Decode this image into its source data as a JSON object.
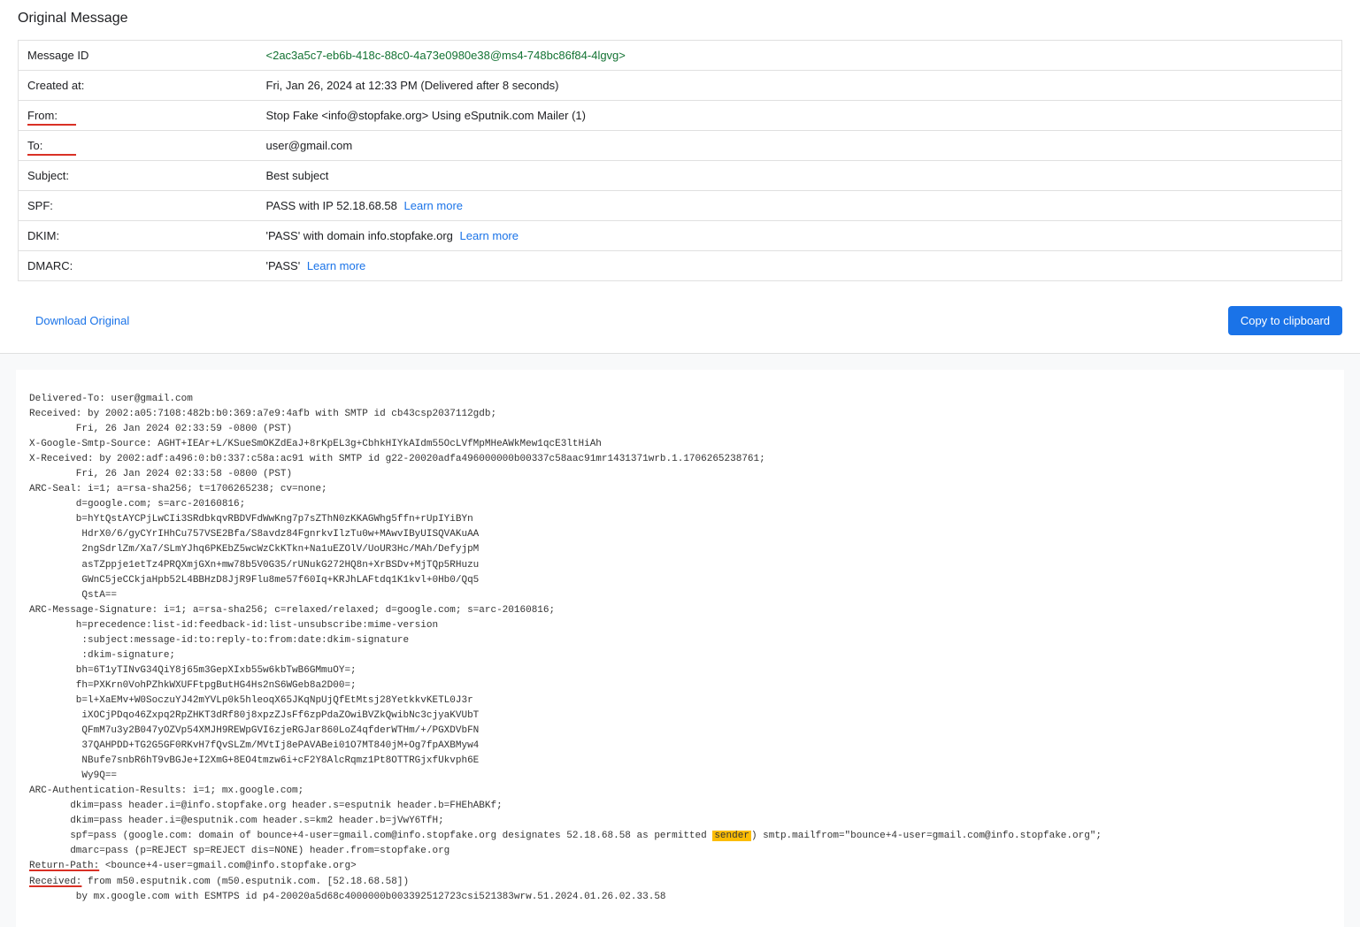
{
  "title": "Original Message",
  "rows": {
    "messageId": {
      "label": "Message ID",
      "value": "<2ac3a5c7-eb6b-418c-88c0-4a73e0980e38@ms4-748bc86f84-4lgvg>"
    },
    "createdAt": {
      "label": "Created at:",
      "value": "Fri, Jan 26, 2024 at 12:33 PM (Delivered after 8 seconds)"
    },
    "from": {
      "label": "From:",
      "value": "Stop Fake <info@stopfake.org> Using eSputnik.com Mailer (1)"
    },
    "to": {
      "label": "To:",
      "value": "user@gmail.com"
    },
    "subject": {
      "label": "Subject:",
      "value": "Best subject"
    },
    "spf": {
      "label": "SPF:",
      "value": "PASS with IP 52.18.68.58",
      "learnMore": "Learn more"
    },
    "dkim": {
      "label": "DKIM:",
      "value": "'PASS' with domain info.stopfake.org",
      "learnMore": "Learn more"
    },
    "dmarc": {
      "label": "DMARC:",
      "value": "'PASS'",
      "learnMore": "Learn more"
    }
  },
  "actions": {
    "download": "Download Original",
    "copy": "Copy to clipboard"
  },
  "raw": {
    "l1": "Delivered-To: user@gmail.com",
    "l2": "Received: by 2002:a05:7108:482b:b0:369:a7e9:4afb with SMTP id cb43csp2037112gdb;",
    "l3": "        Fri, 26 Jan 2024 02:33:59 -0800 (PST)",
    "l4": "X-Google-Smtp-Source: AGHT+IEAr+L/KSueSmOKZdEaJ+8rKpEL3g+CbhkHIYkAIdm55OcLVfMpMHeAWkMew1qcE3ltHiAh",
    "l5": "X-Received: by 2002:adf:a496:0:b0:337:c58a:ac91 with SMTP id g22-20020adfa496000000b00337c58aac91mr1431371wrb.1.1706265238761;",
    "l6": "        Fri, 26 Jan 2024 02:33:58 -0800 (PST)",
    "l7": "ARC-Seal: i=1; a=rsa-sha256; t=1706265238; cv=none;",
    "l8": "        d=google.com; s=arc-20160816;",
    "l9": "        b=hYtQstAYCPjLwCIi3SRdbkqvRBDVFdWwKng7p7sZThN0zKKAGWhg5ffn+rUpIYiBYn",
    "l10": "         HdrX0/6/gyCYrIHhCu757VSE2Bfa/S8avdz84FgnrkvIlzTu0w+MAwvIByUISQVAKuAA",
    "l11": "         2ngSdrlZm/Xa7/SLmYJhq6PKEbZ5wcWzCkKTkn+Na1uEZOlV/UoUR3Hc/MAh/DefyjpM",
    "l12": "         asTZppje1etTz4PRQXmjGXn+mw78b5V0G35/rUNukG272HQ8n+XrBSDv+MjTQp5RHuzu",
    "l13": "         GWnC5jeCCkjaHpb52L4BBHzD8JjR9Flu8me57f60Iq+KRJhLAFtdq1K1kvl+0Hb0/Qq5",
    "l14": "         QstA==",
    "l15": "ARC-Message-Signature: i=1; a=rsa-sha256; c=relaxed/relaxed; d=google.com; s=arc-20160816;",
    "l16": "        h=precedence:list-id:feedback-id:list-unsubscribe:mime-version",
    "l17": "         :subject:message-id:to:reply-to:from:date:dkim-signature",
    "l18": "         :dkim-signature;",
    "l19": "        bh=6T1yTINvG34QiY8j65m3GepXIxb55w6kbTwB6GMmuOY=;",
    "l20": "        fh=PXKrn0VohPZhkWXUFFtpgButHG4Hs2nS6WGeb8a2D00=;",
    "l21": "        b=l+XaEMv+W0SoczuYJ42mYVLp0k5hleoqX65JKqNpUjQfEtMtsj28YetkkvKETL0J3r",
    "l22": "         iXOCjPDqo46Zxpq2RpZHKT3dRf80j8xpzZJsFf6zpPdaZOwiBVZkQwibNc3cjyaKVUbT",
    "l23": "         QFmM7u3y2B047yOZVp54XMJH9REWpGVI6zjeRGJar860LoZ4qfderWTHm/+/PGXDVbFN",
    "l24": "         37QAHPDD+TG2G5GF0RKvH7fQvSLZm/MVtIj8ePAVABei01O7MT840jM+Og7fpAXBMyw4",
    "l25": "         NBufe7snbR6hT9vBGJe+I2XmG+8EO4tmzw6i+cF2Y8AlcRqmz1Pt8OTTRGjxfUkvph6E",
    "l26": "         Wy9Q==",
    "l27": "ARC-Authentication-Results: i=1; mx.google.com;",
    "l28": "       dkim=pass header.i=@info.stopfake.org header.s=esputnik header.b=FHEhABKf;",
    "l29": "       dkim=pass header.i=@esputnik.com header.s=km2 header.b=jVwY6TfH;",
    "l30a": "       spf=pass (google.com: domain of bounce+4-user=gmail.com@info.stopfake.org designates 52.18.68.58 as permitted ",
    "l30b": "sender",
    "l30c": ") smtp.mailfrom=\"bounce+4-user=gmail.com@info.stopfake.org\";",
    "l31": "       dmarc=pass (p=REJECT sp=REJECT dis=NONE) header.from=stopfake.org",
    "l32a": "Return-Path:",
    "l32b": " <bounce+4-user=gmail.com@info.stopfake.org>",
    "l33a": "Received:",
    "l33b": " from m50.esputnik.com (m50.esputnik.com. [52.18.68.58])",
    "l34": "        by mx.google.com with ESMTPS id p4-20020a5d68c4000000b003392512723csi521383wrw.51.2024.01.26.02.33.58"
  }
}
